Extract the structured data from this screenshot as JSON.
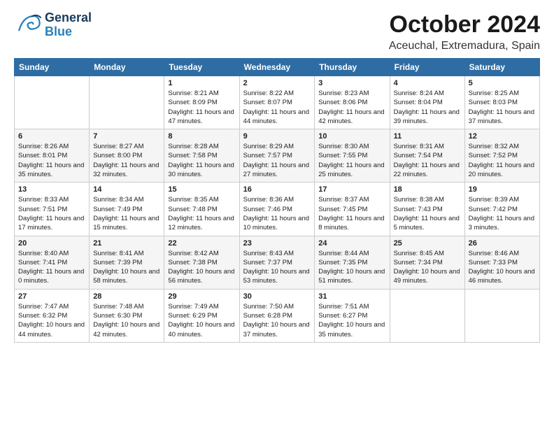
{
  "header": {
    "logo_general": "General",
    "logo_blue": "Blue",
    "month": "October 2024",
    "location": "Aceuchal, Extremadura, Spain"
  },
  "days_of_week": [
    "Sunday",
    "Monday",
    "Tuesday",
    "Wednesday",
    "Thursday",
    "Friday",
    "Saturday"
  ],
  "weeks": [
    [
      {
        "day": "",
        "info": ""
      },
      {
        "day": "",
        "info": ""
      },
      {
        "day": "1",
        "info": "Sunrise: 8:21 AM\nSunset: 8:09 PM\nDaylight: 11 hours and 47 minutes."
      },
      {
        "day": "2",
        "info": "Sunrise: 8:22 AM\nSunset: 8:07 PM\nDaylight: 11 hours and 44 minutes."
      },
      {
        "day": "3",
        "info": "Sunrise: 8:23 AM\nSunset: 8:06 PM\nDaylight: 11 hours and 42 minutes."
      },
      {
        "day": "4",
        "info": "Sunrise: 8:24 AM\nSunset: 8:04 PM\nDaylight: 11 hours and 39 minutes."
      },
      {
        "day": "5",
        "info": "Sunrise: 8:25 AM\nSunset: 8:03 PM\nDaylight: 11 hours and 37 minutes."
      }
    ],
    [
      {
        "day": "6",
        "info": "Sunrise: 8:26 AM\nSunset: 8:01 PM\nDaylight: 11 hours and 35 minutes."
      },
      {
        "day": "7",
        "info": "Sunrise: 8:27 AM\nSunset: 8:00 PM\nDaylight: 11 hours and 32 minutes."
      },
      {
        "day": "8",
        "info": "Sunrise: 8:28 AM\nSunset: 7:58 PM\nDaylight: 11 hours and 30 minutes."
      },
      {
        "day": "9",
        "info": "Sunrise: 8:29 AM\nSunset: 7:57 PM\nDaylight: 11 hours and 27 minutes."
      },
      {
        "day": "10",
        "info": "Sunrise: 8:30 AM\nSunset: 7:55 PM\nDaylight: 11 hours and 25 minutes."
      },
      {
        "day": "11",
        "info": "Sunrise: 8:31 AM\nSunset: 7:54 PM\nDaylight: 11 hours and 22 minutes."
      },
      {
        "day": "12",
        "info": "Sunrise: 8:32 AM\nSunset: 7:52 PM\nDaylight: 11 hours and 20 minutes."
      }
    ],
    [
      {
        "day": "13",
        "info": "Sunrise: 8:33 AM\nSunset: 7:51 PM\nDaylight: 11 hours and 17 minutes."
      },
      {
        "day": "14",
        "info": "Sunrise: 8:34 AM\nSunset: 7:49 PM\nDaylight: 11 hours and 15 minutes."
      },
      {
        "day": "15",
        "info": "Sunrise: 8:35 AM\nSunset: 7:48 PM\nDaylight: 11 hours and 12 minutes."
      },
      {
        "day": "16",
        "info": "Sunrise: 8:36 AM\nSunset: 7:46 PM\nDaylight: 11 hours and 10 minutes."
      },
      {
        "day": "17",
        "info": "Sunrise: 8:37 AM\nSunset: 7:45 PM\nDaylight: 11 hours and 8 minutes."
      },
      {
        "day": "18",
        "info": "Sunrise: 8:38 AM\nSunset: 7:43 PM\nDaylight: 11 hours and 5 minutes."
      },
      {
        "day": "19",
        "info": "Sunrise: 8:39 AM\nSunset: 7:42 PM\nDaylight: 11 hours and 3 minutes."
      }
    ],
    [
      {
        "day": "20",
        "info": "Sunrise: 8:40 AM\nSunset: 7:41 PM\nDaylight: 11 hours and 0 minutes."
      },
      {
        "day": "21",
        "info": "Sunrise: 8:41 AM\nSunset: 7:39 PM\nDaylight: 10 hours and 58 minutes."
      },
      {
        "day": "22",
        "info": "Sunrise: 8:42 AM\nSunset: 7:38 PM\nDaylight: 10 hours and 56 minutes."
      },
      {
        "day": "23",
        "info": "Sunrise: 8:43 AM\nSunset: 7:37 PM\nDaylight: 10 hours and 53 minutes."
      },
      {
        "day": "24",
        "info": "Sunrise: 8:44 AM\nSunset: 7:35 PM\nDaylight: 10 hours and 51 minutes."
      },
      {
        "day": "25",
        "info": "Sunrise: 8:45 AM\nSunset: 7:34 PM\nDaylight: 10 hours and 49 minutes."
      },
      {
        "day": "26",
        "info": "Sunrise: 8:46 AM\nSunset: 7:33 PM\nDaylight: 10 hours and 46 minutes."
      }
    ],
    [
      {
        "day": "27",
        "info": "Sunrise: 7:47 AM\nSunset: 6:32 PM\nDaylight: 10 hours and 44 minutes."
      },
      {
        "day": "28",
        "info": "Sunrise: 7:48 AM\nSunset: 6:30 PM\nDaylight: 10 hours and 42 minutes."
      },
      {
        "day": "29",
        "info": "Sunrise: 7:49 AM\nSunset: 6:29 PM\nDaylight: 10 hours and 40 minutes."
      },
      {
        "day": "30",
        "info": "Sunrise: 7:50 AM\nSunset: 6:28 PM\nDaylight: 10 hours and 37 minutes."
      },
      {
        "day": "31",
        "info": "Sunrise: 7:51 AM\nSunset: 6:27 PM\nDaylight: 10 hours and 35 minutes."
      },
      {
        "day": "",
        "info": ""
      },
      {
        "day": "",
        "info": ""
      }
    ]
  ]
}
